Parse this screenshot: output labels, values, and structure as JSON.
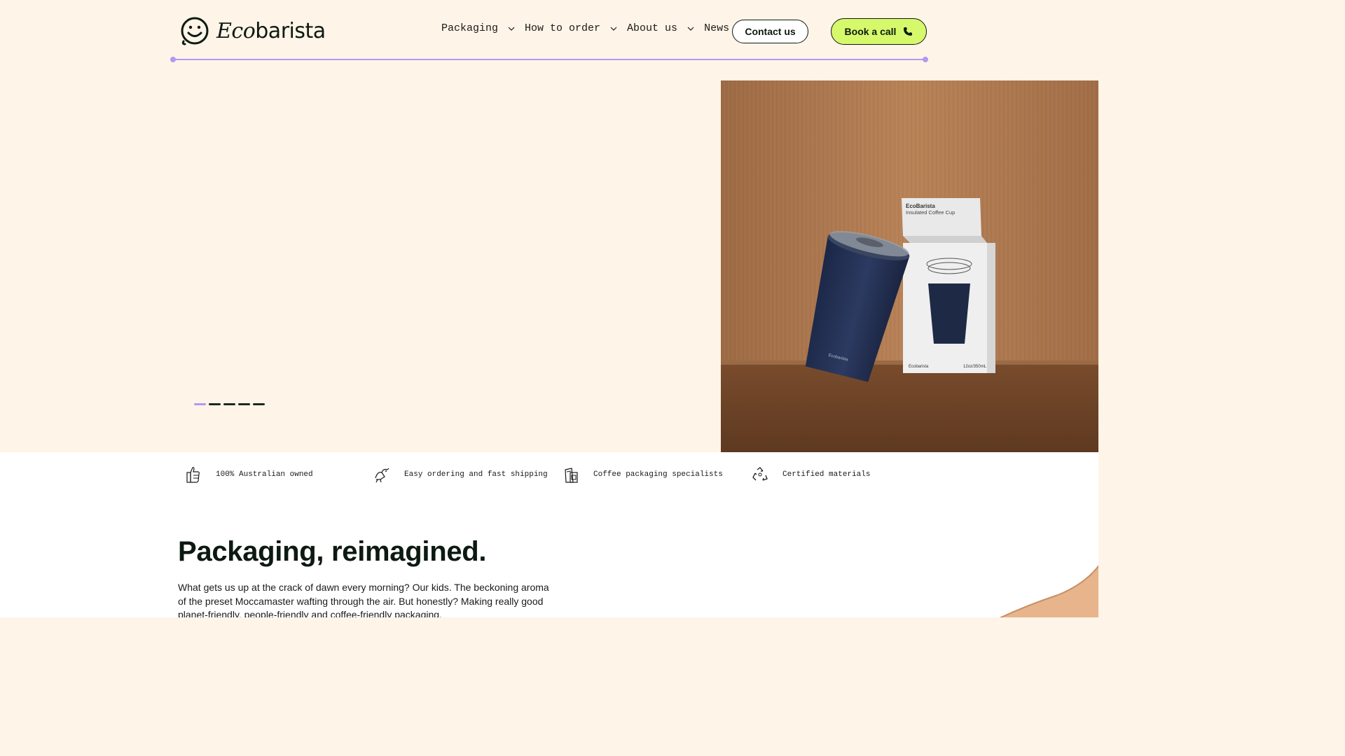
{
  "header": {
    "logo_text_italic": "Eco",
    "logo_text_rest": "barista",
    "nav": [
      {
        "label": "Packaging",
        "has_dropdown": true
      },
      {
        "label": "How to order",
        "has_dropdown": true
      },
      {
        "label": "About us",
        "has_dropdown": true
      },
      {
        "label": "News",
        "has_dropdown": false
      }
    ],
    "contact_label": "Contact us",
    "book_label": "Book a call"
  },
  "hero": {
    "slide_count": 5,
    "active_slide": 1,
    "image": {
      "box_brand": "EcoBarista",
      "box_product": "Insulated Coffee Cup",
      "box_logo": "Ecobarista",
      "box_size": "12oz/350mL",
      "cup_brand": "Ecobarista"
    }
  },
  "features": [
    {
      "icon": "thumbs-up-icon",
      "label": "100% Australian owned"
    },
    {
      "icon": "delivery-bird-icon",
      "label": "Easy ordering and fast shipping"
    },
    {
      "icon": "coffee-packaging-icon",
      "label": "Coffee packaging specialists"
    },
    {
      "icon": "recycle-icon",
      "label": "Certified materials"
    }
  ],
  "intro": {
    "title": "Packaging, reimagined.",
    "text": "What gets us up at the crack of dawn every morning? Our kids. The beckoning aroma of the preset Moccamaster wafting through the air. But honestly? Making really good planet-friendly, people-friendly and coffee-friendly packaging."
  },
  "colors": {
    "background": "#fff4e8",
    "accent_lime": "#d6f86b",
    "accent_purple": "#b697f2",
    "text_dark": "#0d1a12"
  }
}
